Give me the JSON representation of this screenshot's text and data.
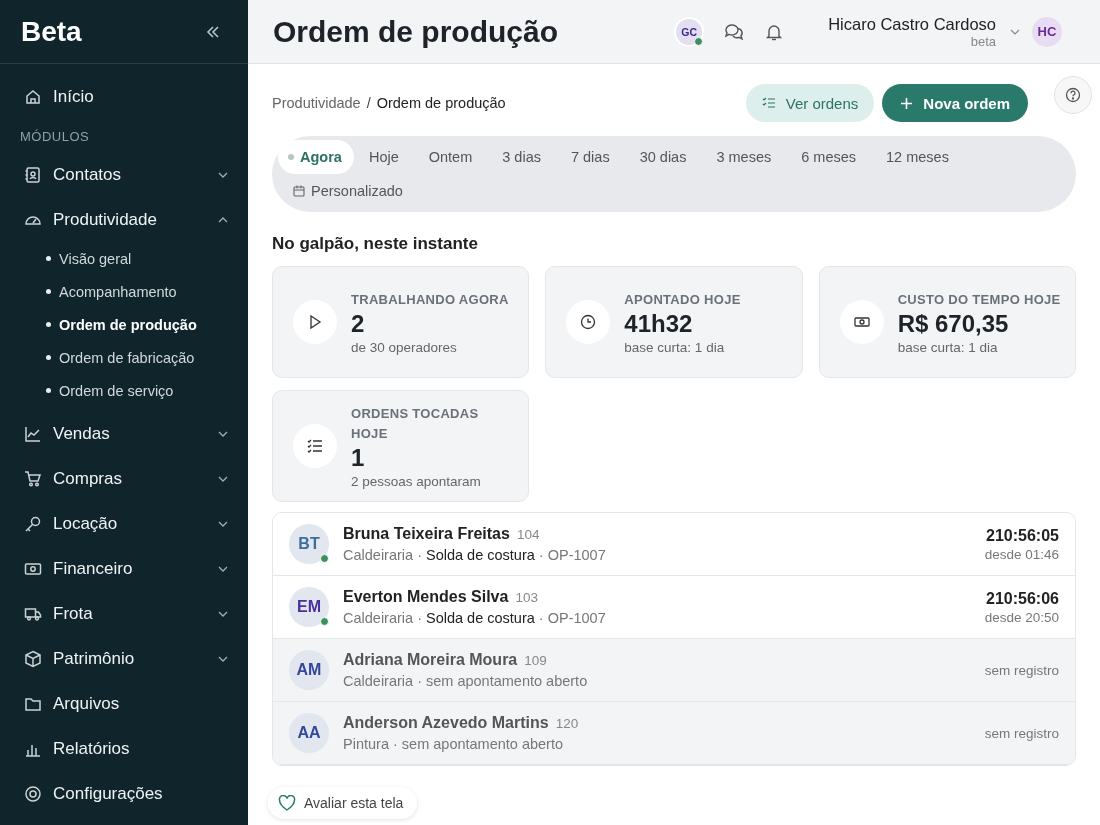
{
  "sidebar": {
    "logo": "Beta",
    "section": "MÓDULOS",
    "items": [
      {
        "label": "Início"
      },
      {
        "label": "Contatos",
        "expanded": false
      },
      {
        "label": "Produtividade",
        "expanded": true,
        "children": [
          {
            "label": "Visão geral",
            "selected": false
          },
          {
            "label": "Acompanhamento",
            "selected": false
          },
          {
            "label": "Ordem de produção",
            "selected": true
          },
          {
            "label": "Ordem de fabricação",
            "selected": false
          },
          {
            "label": "Ordem de serviço",
            "selected": false
          }
        ]
      },
      {
        "label": "Vendas",
        "expanded": false
      },
      {
        "label": "Compras",
        "expanded": false
      },
      {
        "label": "Locação",
        "expanded": false
      },
      {
        "label": "Financeiro",
        "expanded": false
      },
      {
        "label": "Frota",
        "expanded": false
      },
      {
        "label": "Patrimônio",
        "expanded": false
      },
      {
        "label": "Arquivos"
      },
      {
        "label": "Relatórios"
      },
      {
        "label": "Configurações"
      }
    ]
  },
  "header": {
    "title": "Ordem de produção",
    "team_avatar": {
      "initials": "GC",
      "online": true
    },
    "user": {
      "name": "Hicaro Castro Cardoso",
      "role": "beta",
      "initials": "HC"
    }
  },
  "breadcrumb": [
    "Produtividade",
    "Ordem de produção"
  ],
  "breadcrumb_separator": "/",
  "actions": [
    {
      "label": "Ver ordens",
      "kind": "secondary"
    },
    {
      "label": "Nova ordem",
      "kind": "primary"
    }
  ],
  "periods": [
    {
      "label": "Agora",
      "selected": true
    },
    {
      "label": "Hoje",
      "selected": false
    },
    {
      "label": "Ontem",
      "selected": false
    },
    {
      "label": "3 dias",
      "selected": false
    },
    {
      "label": "7 dias",
      "selected": false
    },
    {
      "label": "30 dias",
      "selected": false
    },
    {
      "label": "3 meses",
      "selected": false
    },
    {
      "label": "6 meses",
      "selected": false
    },
    {
      "label": "12 meses",
      "selected": false
    },
    {
      "label": "Personalizado",
      "selected": false
    }
  ],
  "section_title": "No galpão, neste instante",
  "stats": [
    {
      "label": "TRABALHANDO AGORA",
      "value": "2",
      "note": "de 30 operadores"
    },
    {
      "label": "APONTADO HOJE",
      "value": "41h32",
      "note": "base curta: 1 dia"
    },
    {
      "label": "CUSTO DO TEMPO HOJE",
      "value": "R$ 670,35",
      "note": "base curta: 1 dia"
    },
    {
      "label": "ORDENS TOCADAS HOJE",
      "value": "1",
      "note": "2 pessoas apontaram"
    }
  ],
  "workers": [
    {
      "initials": "BT",
      "color": "#3b6e9a",
      "name": "Bruna Teixeira Freitas",
      "code": "104",
      "detail": "Caldeiraria · **Solda de costura** · OP-1007",
      "active": true,
      "online": true,
      "time": "210:56:05",
      "since": "desde 01:46"
    },
    {
      "initials": "EM",
      "color": "#4a2fa0",
      "name": "Everton Mendes Silva",
      "code": "103",
      "detail": "Caldeiraria · **Solda de costura** · OP-1007",
      "active": true,
      "online": true,
      "time": "210:56:06",
      "since": "desde 20:50"
    },
    {
      "initials": "AM",
      "color": "#34479a",
      "name": "Adriana Moreira Moura",
      "code": "109",
      "detail": "Caldeiraria · sem apontamento aberto",
      "active": false,
      "online": false,
      "status": "sem registro"
    },
    {
      "initials": "AA",
      "color": "#34479a",
      "name": "Anderson Azevedo Martins",
      "code": "120",
      "detail": "Pintura · sem apontamento aberto",
      "active": false,
      "online": false,
      "status": "sem registro"
    }
  ],
  "feedback": {
    "label": "Avaliar esta tela"
  }
}
